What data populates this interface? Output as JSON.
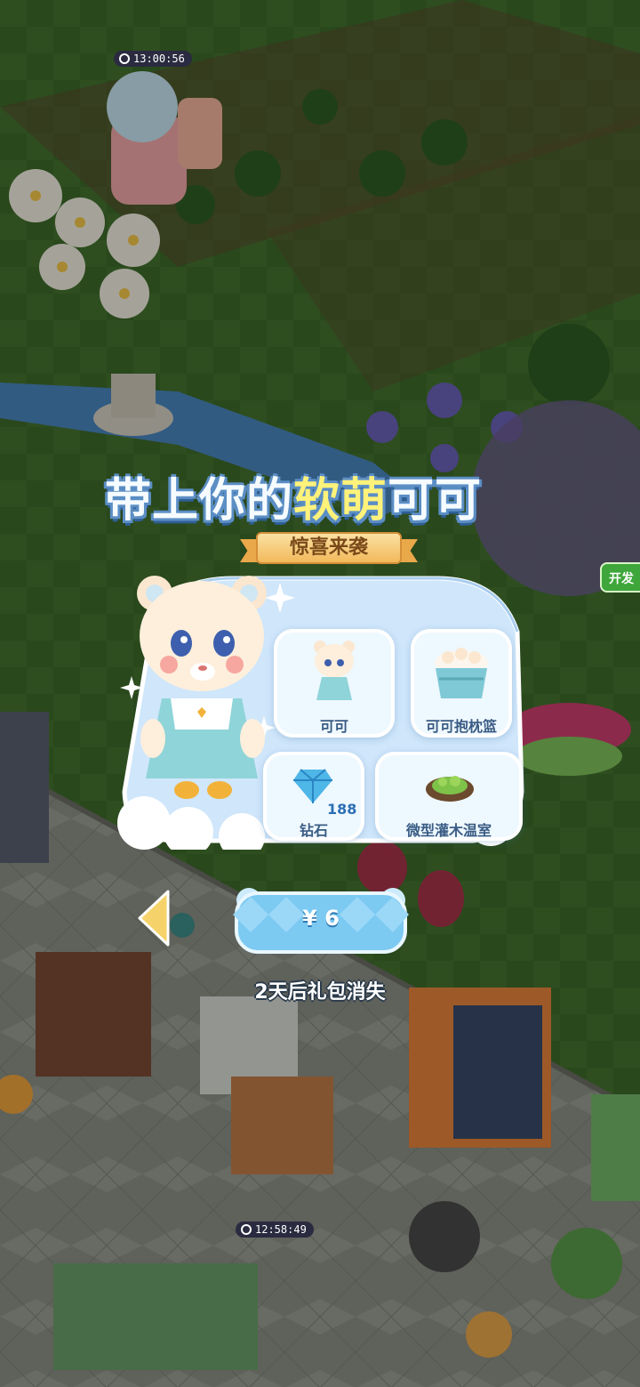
{
  "timers": {
    "top": "13:00:56",
    "bottom": "12:58:49"
  },
  "side_button": {
    "label": "开发"
  },
  "popup": {
    "title_part1": "带上你的",
    "title_part2": "软萌",
    "title_part3": "可可",
    "subtitle": "惊喜来袭",
    "items": [
      {
        "label": "可可",
        "icon": "bear-doll-icon"
      },
      {
        "label": "可可抱枕篮",
        "icon": "pillow-basket-icon"
      },
      {
        "label": "钻石",
        "icon": "diamond-icon",
        "count": "188"
      },
      {
        "label": "微型灌木温室",
        "icon": "mini-greenhouse-icon"
      }
    ],
    "price": "¥ 6",
    "expiry_note": "2天后礼包消失"
  },
  "colors": {
    "title_fill": "#f5fbff",
    "title_highlight": "#fff27a",
    "card_blue": "#cfe6fb",
    "price_button": "#7cc9f2"
  }
}
